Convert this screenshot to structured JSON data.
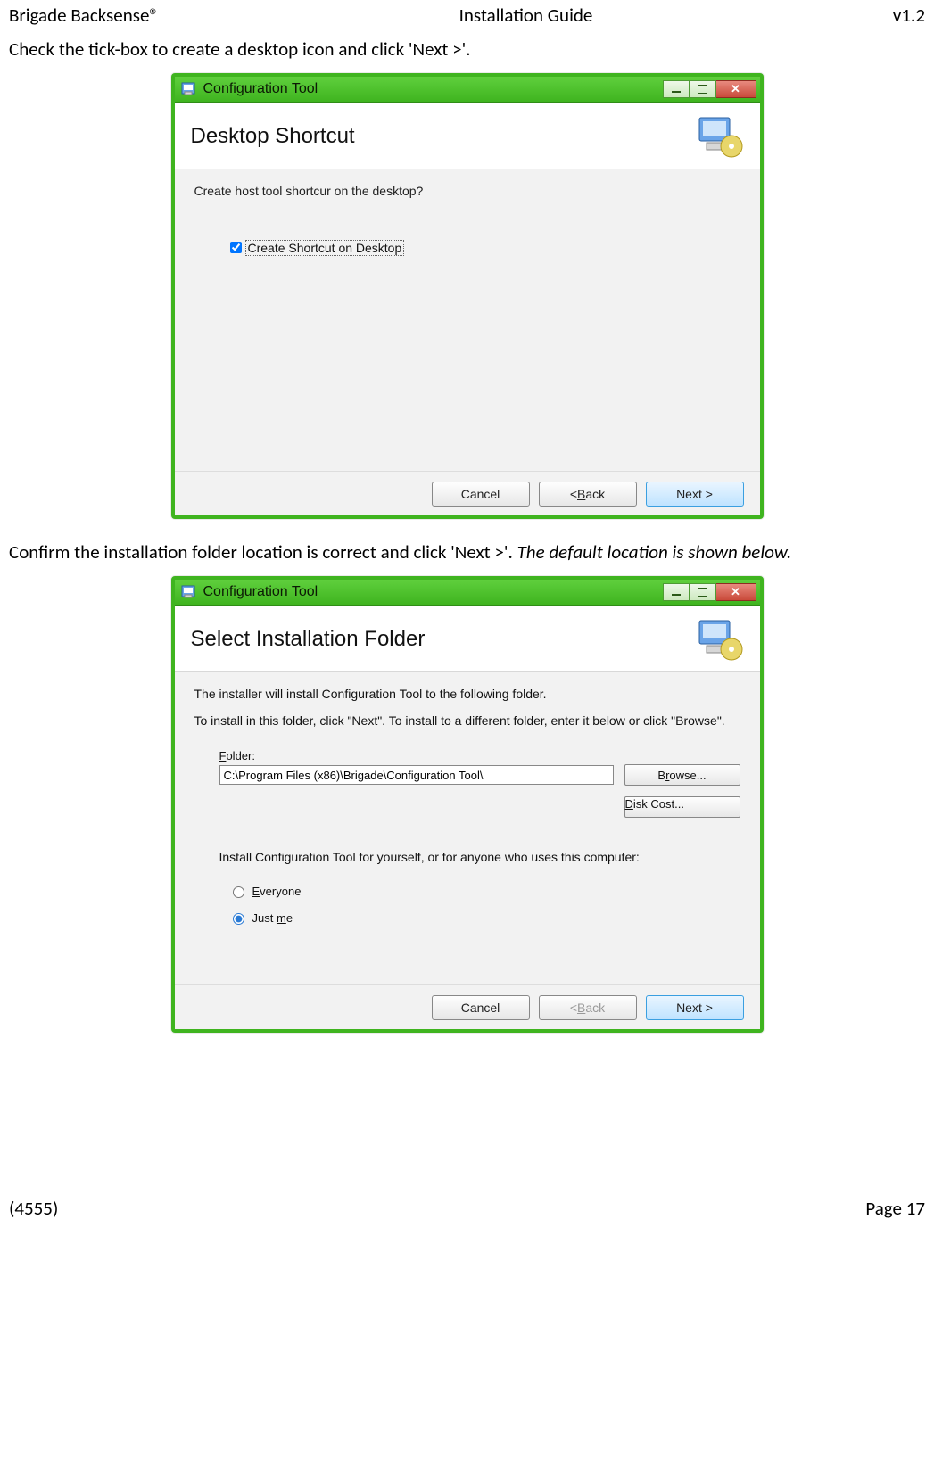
{
  "header": {
    "left": "Brigade Backsense®",
    "center": "Installation Guide",
    "right": "v1.2"
  },
  "footer": {
    "left": "(4555)",
    "right": "Page 17"
  },
  "instruction1": "Check the tick-box to create a desktop icon and click 'Next >'.",
  "instruction2_plain": "Confirm the installation folder location is correct and click 'Next >'. ",
  "instruction2_italic": "The default location is shown below.",
  "dialog1": {
    "title": "Configuration Tool",
    "banner": "Desktop Shortcut",
    "prompt": "Create host tool shortcur on the desktop?",
    "checkbox_label": "Create Shortcut on Desktop",
    "cancel": "Cancel",
    "back_prefix": "< ",
    "back_u": "B",
    "back_suffix": "ack",
    "next": "Next >"
  },
  "dialog2": {
    "title": "Configuration Tool",
    "banner": "Select Installation Folder",
    "line1": "The installer will install Configuration Tool to the following folder.",
    "line2": "To install in this folder, click \"Next\". To install to a different folder, enter it below or click \"Browse\".",
    "folder_label_u": "F",
    "folder_label_rest": "older:",
    "folder_value": "C:\\Program Files (x86)\\Brigade\\Configuration Tool\\",
    "browse_pre": "B",
    "browse_u": "r",
    "browse_post": "owse...",
    "diskcost_u": "D",
    "diskcost_rest": "isk Cost...",
    "scope_prompt": "Install Configuration Tool for yourself, or for anyone who uses this computer:",
    "radio_everyone_u": "E",
    "radio_everyone_rest": "veryone",
    "radio_justme_pre": "Just ",
    "radio_justme_u": "m",
    "radio_justme_post": "e",
    "cancel": "Cancel",
    "back_prefix": "< ",
    "back_u": "B",
    "back_suffix": "ack",
    "next": "Next >"
  }
}
